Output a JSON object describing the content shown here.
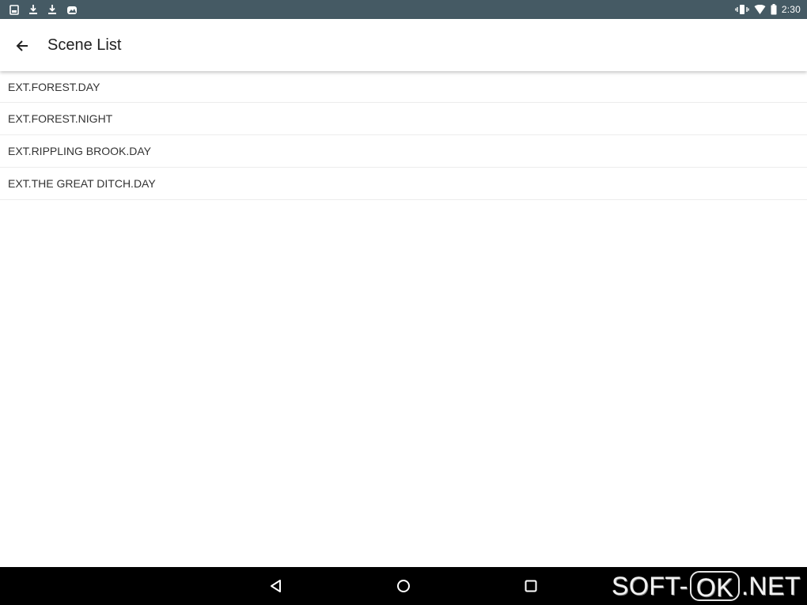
{
  "status_bar": {
    "left_icons": [
      "sim-card-icon",
      "download-icon",
      "download-icon",
      "photo-icon"
    ],
    "right_icons": [
      "vibrate-icon",
      "wifi-icon",
      "battery-icon"
    ],
    "time": "2:30",
    "background_color": "#455a64"
  },
  "app_bar": {
    "back_icon": "arrow-back-icon",
    "title": "Scene List"
  },
  "scenes": [
    {
      "label": "EXT.FOREST.DAY"
    },
    {
      "label": "EXT.FOREST.NIGHT"
    },
    {
      "label": "EXT.RIPPLING BROOK.DAY"
    },
    {
      "label": "EXT.THE GREAT DITCH.DAY"
    }
  ],
  "nav_bar": {
    "back_icon": "nav-back-triangle-icon",
    "home_icon": "nav-home-circle-icon",
    "recents_icon": "nav-recents-square-icon",
    "background_color": "#000000"
  },
  "watermark": {
    "left": "SOFT-",
    "boxed": "OK",
    "right": ".NET"
  }
}
